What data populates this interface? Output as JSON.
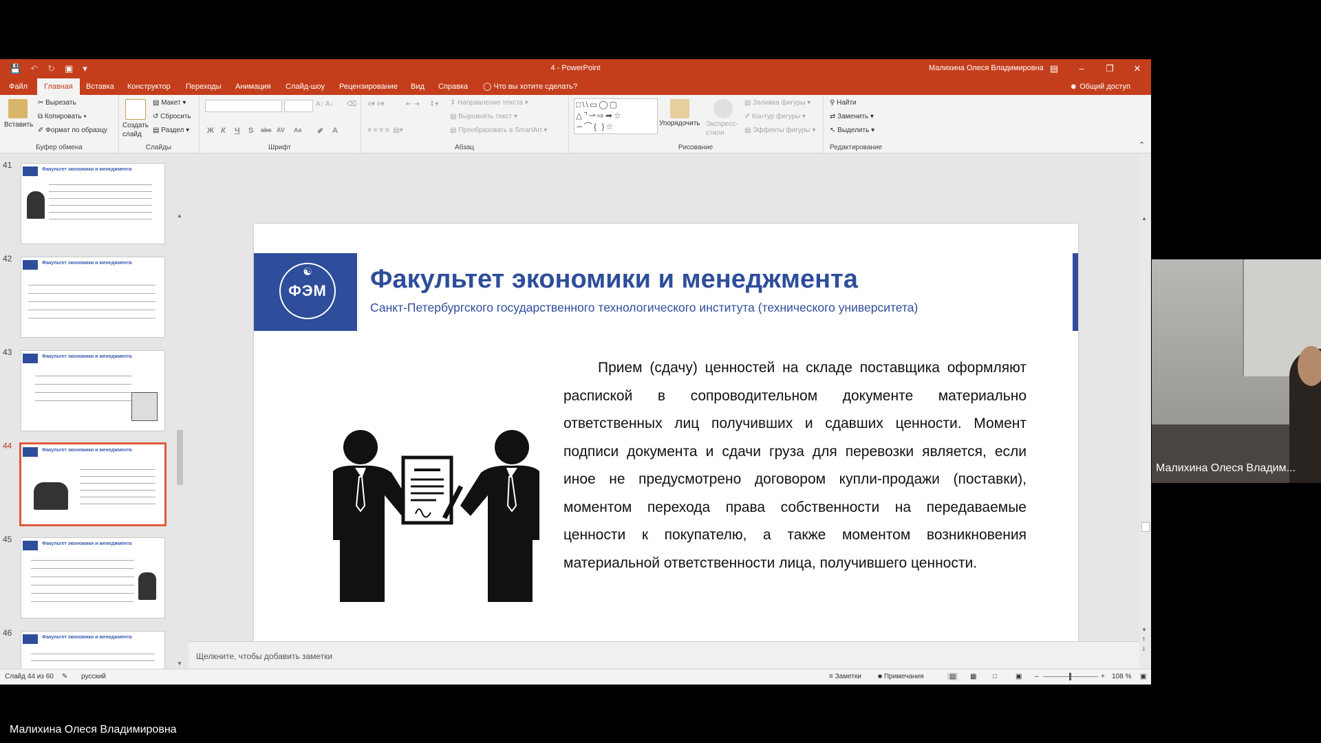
{
  "titlebar": {
    "document": "4  -  PowerPoint",
    "user": "Малихина Олеся Владимировна"
  },
  "menu": {
    "tabs": [
      "Файл",
      "Главная",
      "Вставка",
      "Конструктор",
      "Переходы",
      "Анимация",
      "Слайд-шоу",
      "Рецензирование",
      "Вид",
      "Справка"
    ],
    "active_tab": "Главная",
    "tell_me": "Что вы хотите сделать?",
    "share": "Общий доступ"
  },
  "ribbon": {
    "clipboard": {
      "paste": "Вставить",
      "cut": "Вырезать",
      "copy": "Копировать",
      "format_painter": "Формат по образцу",
      "label": "Буфер обмена"
    },
    "slides": {
      "new_slide": "Создать слайд",
      "layout": "Макет",
      "reset": "Сбросить",
      "section": "Раздел",
      "label": "Слайды"
    },
    "font": {
      "label": "Шрифт"
    },
    "paragraph": {
      "text_direction": "Направление текста",
      "align_text": "Выровнять текст",
      "smartart": "Преобразовать в SmartArt",
      "label": "Абзац"
    },
    "drawing": {
      "arrange": "Упорядочить",
      "quick_styles": "Экспресс-стили",
      "shape_fill": "Заливка фигуры",
      "shape_outline": "Контур фигуры",
      "shape_effects": "Эффекты фигуры",
      "label": "Рисование"
    },
    "editing": {
      "find": "Найти",
      "replace": "Заменить",
      "select": "Выделить",
      "label": "Редактирование"
    }
  },
  "thumbnails": {
    "numbers": [
      "41",
      "42",
      "43",
      "44",
      "45",
      "46"
    ],
    "selected": "44",
    "thumb_title": "Факультет экономики и менеджмента"
  },
  "slide": {
    "logo_text": "ФЭМ",
    "title": "Факультет экономики и менеджмента",
    "subtitle": "Санкт-Петербургского государственного технологического института (технического университета)",
    "body": "Прием (сдачу) ценностей на складе поставщика оформляют распиской в сопроводительном документе материально ответственных лиц получивших и сдавших ценности. Момент подписи документа и сдачи груза для перевозки является, если иное не предусмотрено договором купли-продажи (поставки), моментом перехода права собственности на передаваемые ценности к покупателю, а также моментом возникновения материальной ответственности лица, получившего ценности."
  },
  "notes_placeholder": "Щелкните, чтобы добавить заметки",
  "statusbar": {
    "slide_info": "Слайд 44 из 60",
    "language": "русский",
    "notes": "Заметки",
    "comments": "Примечания",
    "zoom": "108 %"
  },
  "webcam": {
    "name": "Малихина Олеся Владим..."
  },
  "presenter": {
    "name": "Малихина Олеся Владимировна"
  },
  "colors": {
    "accent": "#c43e1c",
    "slide_blue": "#2e4d9b",
    "selection": "#e05a3a"
  }
}
